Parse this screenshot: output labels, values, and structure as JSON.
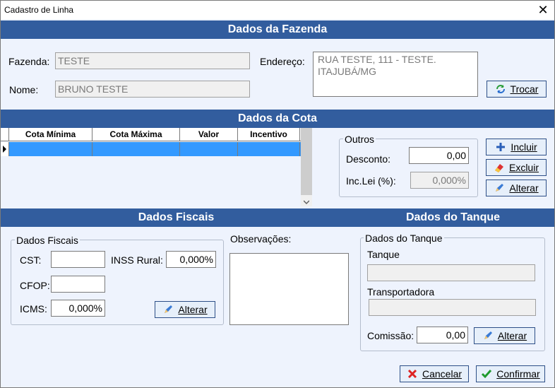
{
  "window": {
    "title": "Cadastro de Linha"
  },
  "sections": {
    "fazenda": "Dados da Fazenda",
    "cota": "Dados da Cota",
    "fiscais": "Dados Fiscais",
    "tanque": "Dados do Tanque"
  },
  "fazenda": {
    "fazenda_label": "Fazenda:",
    "fazenda_value": "TESTE",
    "nome_label": "Nome:",
    "nome_value": "BRUNO TESTE",
    "endereco_label": "Endereço:",
    "endereco_line1": "RUA TESTE, 111 - TESTE.",
    "endereco_line2": "ITAJUBÁ/MG",
    "trocar_label": "Trocar"
  },
  "cota": {
    "columns": [
      "Cota Mínima",
      "Cota Máxima",
      "Valor",
      "Incentivo"
    ],
    "outros_title": "Outros",
    "desconto_label": "Desconto:",
    "desconto_value": "0,00",
    "inclei_label": "Inc.Lei (%):",
    "inclei_value": "0,000%",
    "incluir_label": "Incluir",
    "excluir_label": "Excluir",
    "alterar_label": "Alterar"
  },
  "fiscais": {
    "group_title": "Dados Fiscais",
    "cst_label": "CST:",
    "cst_value": "",
    "inss_label": "INSS Rural:",
    "inss_value": "0,000%",
    "cfop_label": "CFOP:",
    "cfop_value": "",
    "icms_label": "ICMS:",
    "icms_value": "0,000%",
    "alterar_label": "Alterar"
  },
  "observacoes": {
    "label": "Observações:"
  },
  "tanque": {
    "group_title": "Dados do Tanque",
    "tanque_label": "Tanque",
    "transportadora_label": "Transportadora",
    "comissao_label": "Comissão:",
    "comissao_value": "0,00",
    "alterar_label": "Alterar"
  },
  "footer": {
    "cancelar_label": "Cancelar",
    "confirmar_label": "Confirmar"
  }
}
